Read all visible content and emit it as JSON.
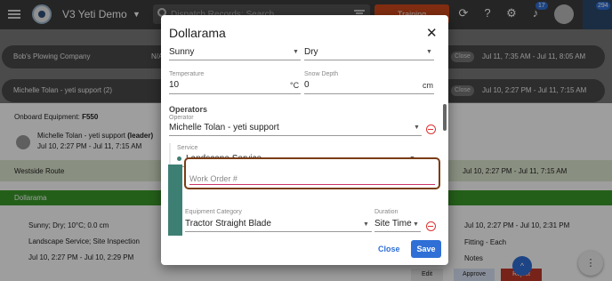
{
  "app": {
    "title": "V3 Yeti Demo",
    "search_placeholder": "Dispatch Records: Search",
    "training_label": "Training",
    "notifications_count": "17",
    "chat_count": "294"
  },
  "background": {
    "rows": [
      {
        "name": "Bob's Plowing Company",
        "na": "N/A",
        "pill": "Close",
        "time": "Jul 11, 7:35 AM - Jul 11, 8:05 AM"
      },
      {
        "name": "Michelle Tolan - yeti support (2)",
        "pill": "Close",
        "time": "Jul 10, 2:27 PM - Jul 11, 7:15 AM"
      }
    ],
    "onboard_label": "Onboard Equipment:",
    "onboard_value": "F550",
    "crew_member": "Michelle Tolan - yeti support",
    "crew_role": "(leader)",
    "crew_time": "Jul 10, 2:27 PM - Jul 11, 7:15 AM",
    "route_name": "Westside Route",
    "route_time": "Jul 10, 2:27 PM - Jul 11, 7:15 AM",
    "location": "Dollarama",
    "weather": "Sunny; Dry; 10°C; 0.0 cm",
    "services": "Landscape Service; Site Inspection",
    "schedule": "Jul 10, 2:27 PM - Jul 10, 2:29 PM",
    "right_time": "Jul 10, 2:27 PM - Jul 10, 2:31 PM",
    "right_item": "Fitting - Each",
    "notes_label": "Notes",
    "edit_label": "Edit",
    "approve_label": "Approve",
    "reject_label": "Reject"
  },
  "modal": {
    "title": "Dollarama",
    "weather_value": "Sunny",
    "surface_value": "Dry",
    "temperature_label": "Temperature",
    "temperature_value": "10",
    "temperature_unit": "°C",
    "snow_label": "Snow Depth",
    "snow_value": "0",
    "snow_unit": "cm",
    "operators_heading": "Operators",
    "operator_label": "Operator",
    "operator_value": "Michelle Tolan - yeti support",
    "service_label": "Service",
    "service_value": "Landscape Service",
    "work_order_placeholder": "Work Order #",
    "equipment_label": "Equipment Category",
    "equipment_value": "Tractor Straight Blade",
    "duration_label": "Duration",
    "duration_value": "Site Time",
    "close_label": "Close",
    "save_label": "Save"
  },
  "colors": {
    "accent": "#2f6fd6",
    "training": "#d2491c",
    "route_green": "#3a9a2a",
    "teal": "#3e7f74",
    "focus_border": "#7a3d16",
    "remove_red": "#dd3333"
  },
  "icons": [
    "menu-icon",
    "logo-icon",
    "search-icon",
    "filter-icon",
    "refresh-icon",
    "help-icon",
    "gear-icon",
    "bell-icon",
    "avatar",
    "chat-icon",
    "close-icon",
    "remove-icon",
    "caret-down-icon"
  ]
}
